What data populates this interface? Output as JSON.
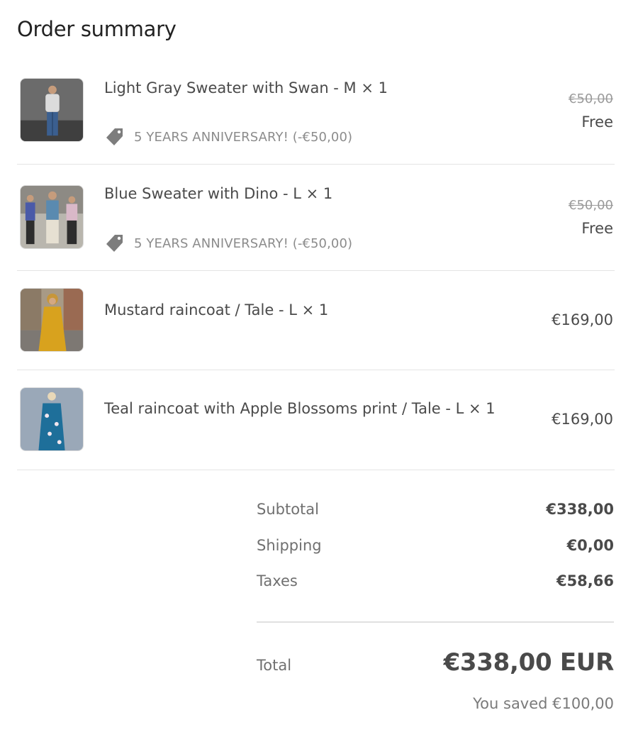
{
  "order_summary": {
    "title": "Order summary"
  },
  "items": [
    {
      "name": "Light Gray Sweater with Swan - M × 1",
      "discount_label": "5 YEARS ANNIVERSARY! (-€50,00)",
      "original_price": "€50,00",
      "final_price": "Free",
      "tag_icon": "price-tag-icon"
    },
    {
      "name": "Blue Sweater with Dino - L × 1",
      "discount_label": "5 YEARS ANNIVERSARY! (-€50,00)",
      "original_price": "€50,00",
      "final_price": "Free",
      "tag_icon": "price-tag-icon"
    },
    {
      "name": "Mustard raincoat / Tale - L × 1",
      "final_price": "€169,00"
    },
    {
      "name": "Teal raincoat with Apple Blossoms print / Tale - L × 1",
      "final_price": "€169,00"
    }
  ],
  "totals": {
    "subtotal_label": "Subtotal",
    "subtotal_value": "€338,00",
    "shipping_label": "Shipping",
    "shipping_value": "€0,00",
    "taxes_label": "Taxes",
    "taxes_value": "€58,66",
    "total_label": "Total",
    "total_value": "€338,00 EUR",
    "saved_text": "You saved €100,00"
  },
  "colors": {
    "text_primary": "#4a4a4a",
    "text_muted": "#8c8c8c",
    "divider": "#e4e4e4",
    "tag_icon": "#7d7d7d"
  }
}
